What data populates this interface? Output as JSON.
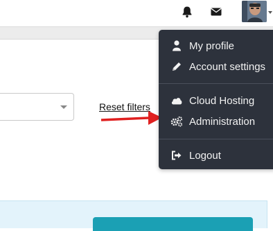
{
  "header": {
    "notifications_icon": "bell-icon",
    "messages_icon": "envelope-icon",
    "avatar_icon": "user-avatar"
  },
  "filters": {
    "reset_label": "Reset filters",
    "select_icon": "chevron-down-icon"
  },
  "user_menu": {
    "items": [
      {
        "label": "My profile",
        "icon": "user-icon"
      },
      {
        "label": "Account settings",
        "icon": "pencil-icon"
      },
      {
        "label": "Cloud Hosting",
        "icon": "cloud-icon"
      },
      {
        "label": "Administration",
        "icon": "gears-icon"
      },
      {
        "label": "Logout",
        "icon": "sign-out-icon"
      }
    ]
  },
  "annotation": {
    "color": "#e02020"
  },
  "colors": {
    "menu_bg": "#2d323c",
    "panel_bg": "#e3f3fb",
    "button_bg": "#1ba0b4"
  }
}
